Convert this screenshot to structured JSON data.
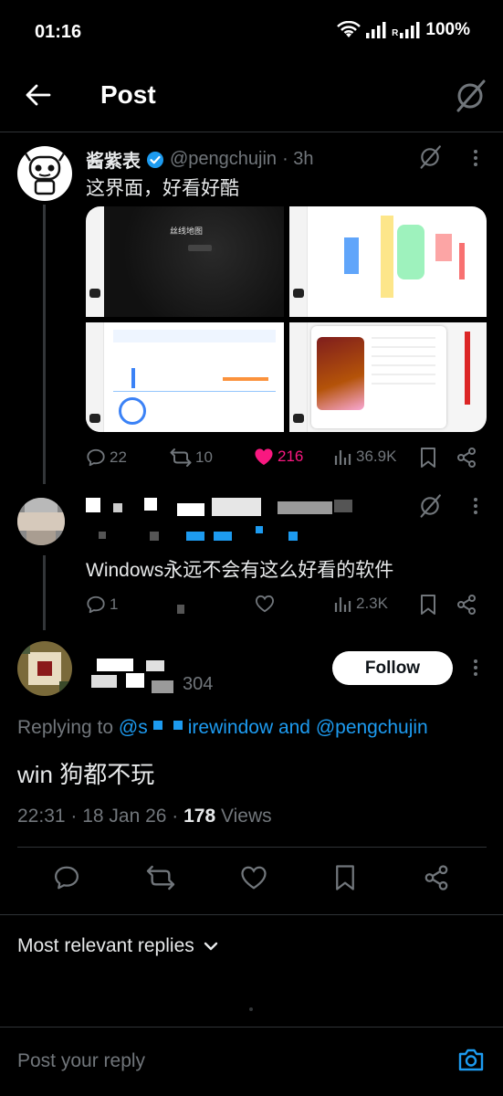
{
  "status": {
    "time": "01:16",
    "battery": "100%",
    "roaming": "R"
  },
  "header": {
    "title": "Post"
  },
  "quoted_post": {
    "name": "酱紫表",
    "handle": "@pengchujin",
    "time": "· 3h",
    "text": "这界面，好看好酷",
    "stats": {
      "replies": "22",
      "reposts": "10",
      "likes": "216",
      "views": "36.9K"
    },
    "media_caption": "丝线地图"
  },
  "reply_1": {
    "text": "Windows永远不会有这么好看的软件",
    "stats": {
      "replies": "1",
      "views": "2.3K"
    }
  },
  "main_post": {
    "handle_fragment": "304",
    "follow_label": "Follow",
    "replying_prefix": "Replying to ",
    "replying_mention_1": "@s",
    "replying_mention_1_tail": "irewindow",
    "replying_and": " and ",
    "replying_mention_2": "@pengchujin",
    "text": "win 狗都不玩",
    "time": "22:31 · 18 Jan 26 · ",
    "views_count": "178",
    "views_label": " Views"
  },
  "replies_section": {
    "sort_label": "Most relevant replies",
    "input_placeholder": "Post your reply"
  },
  "colors": {
    "accent": "#1d9bf0",
    "like": "#f91880",
    "muted": "#71767b",
    "divider": "#2f3336"
  }
}
